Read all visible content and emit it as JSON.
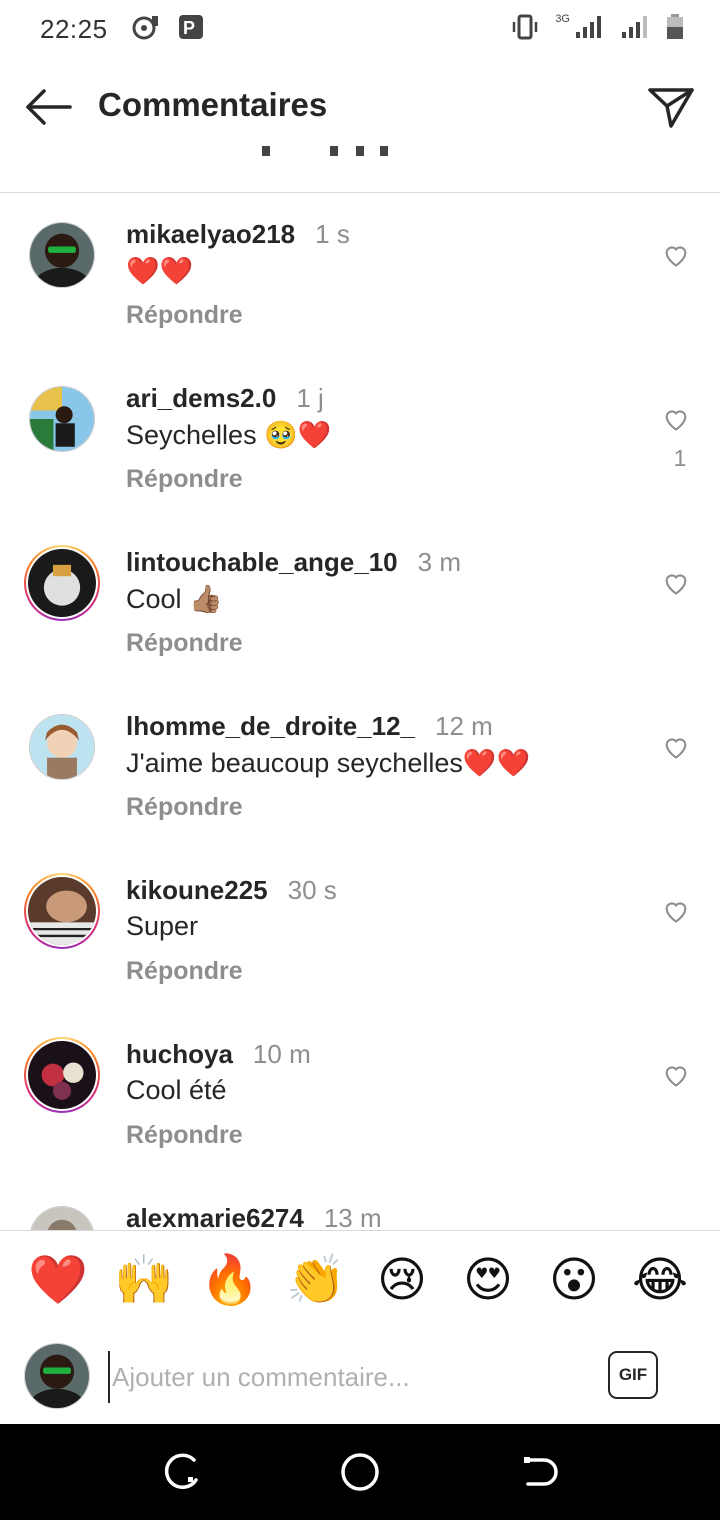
{
  "status": {
    "time": "22:25",
    "network": "3G"
  },
  "header": {
    "title": "Commentaires"
  },
  "comments": [
    {
      "username": "mikaelyao218",
      "time": "1 s",
      "text": "❤️❤️",
      "reply": "Répondre",
      "likes": ""
    },
    {
      "username": "ari_dems2.0",
      "time": "1 j",
      "text": "Seychelles 🥹❤️",
      "reply": "Répondre",
      "likes": "1"
    },
    {
      "username": "lintouchable_ange_10",
      "time": "3 m",
      "text": "Cool 👍🏽",
      "reply": "Répondre",
      "likes": ""
    },
    {
      "username": "lhomme_de_droite_12_",
      "time": "12 m",
      "text": "J'aime beaucoup seychelles❤️❤️",
      "reply": "Répondre",
      "likes": ""
    },
    {
      "username": "kikoune225",
      "time": "30 s",
      "text": "Super",
      "reply": "Répondre",
      "likes": ""
    },
    {
      "username": "huchoya",
      "time": "10 m",
      "text": "Cool été",
      "reply": "Répondre",
      "likes": ""
    },
    {
      "username": "alexmarie6274",
      "time": "13 m",
      "text": "",
      "reply": "",
      "likes": ""
    }
  ],
  "emoji_bar": [
    "❤️",
    "🙌",
    "🔥",
    "👏",
    "😢",
    "😍",
    "😮",
    "😂"
  ],
  "input": {
    "placeholder": "Ajouter un commentaire...",
    "gif_label": "GIF"
  },
  "colors": {
    "accent_ring": "#d62976",
    "secondary_text": "#8e8e8e",
    "primary_text": "#262626"
  }
}
